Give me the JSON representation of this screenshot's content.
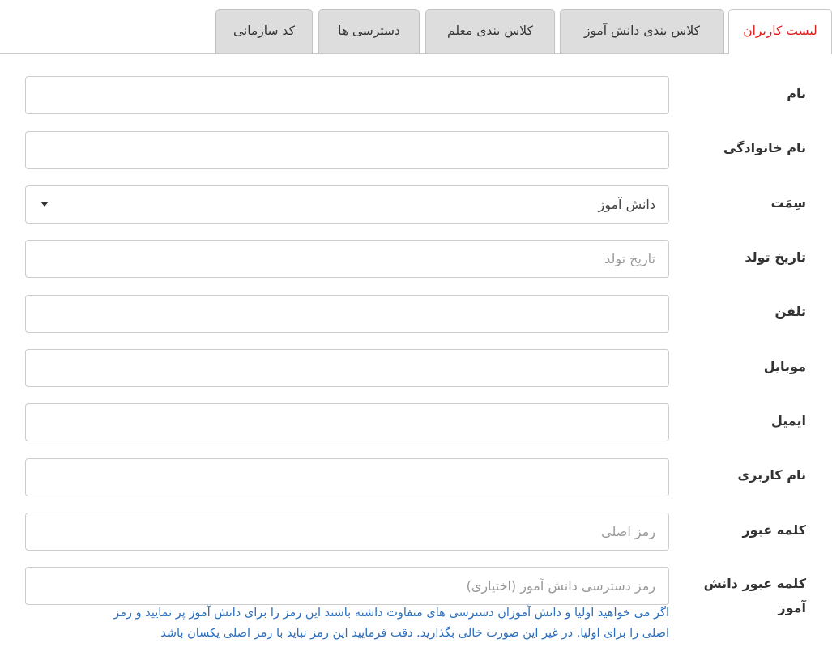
{
  "tabs": [
    {
      "label": "لیست کاربران",
      "active": true
    },
    {
      "label": "کلاس بندی دانش آموز",
      "active": false
    },
    {
      "label": "کلاس بندی معلم",
      "active": false
    },
    {
      "label": "دسترسی ها",
      "active": false
    },
    {
      "label": "کد سازمانی",
      "active": false
    }
  ],
  "form": {
    "first_name": {
      "label": "نام",
      "value": "",
      "placeholder": ""
    },
    "last_name": {
      "label": "نام خانوادگی",
      "value": "",
      "placeholder": ""
    },
    "role": {
      "label": "سِمَت",
      "selected": "دانش آموز"
    },
    "birth_date": {
      "label": "تاریخ تولد",
      "value": "",
      "placeholder": "تاریخ تولد"
    },
    "phone": {
      "label": "تلفن",
      "value": "",
      "placeholder": ""
    },
    "mobile": {
      "label": "موبایل",
      "value": "",
      "placeholder": ""
    },
    "email": {
      "label": "ایمیل",
      "value": "",
      "placeholder": ""
    },
    "username": {
      "label": "نام کاربری",
      "value": "",
      "placeholder": ""
    },
    "password": {
      "label": "کلمه عبور",
      "value": "",
      "placeholder": "رمز اصلی"
    },
    "student_password": {
      "label": "کلمه عبور دانش آموز",
      "value": "",
      "placeholder": "رمز دسترسی دانش آموز (اختیاری)",
      "help": "اگر می خواهید اولیا و دانش آموزان دسترسی های متفاوت داشته باشند این رمز را برای دانش آموز پر نمایید و رمز اصلی را برای اولیا. در غیر این صورت خالی بگذارید. دقت فرمایید این رمز نباید با رمز اصلی یکسان باشد"
    }
  },
  "colors": {
    "active_tab_text": "#e21b1b",
    "help_text": "#2a6ebd",
    "tab_bg": "#dddddd"
  }
}
